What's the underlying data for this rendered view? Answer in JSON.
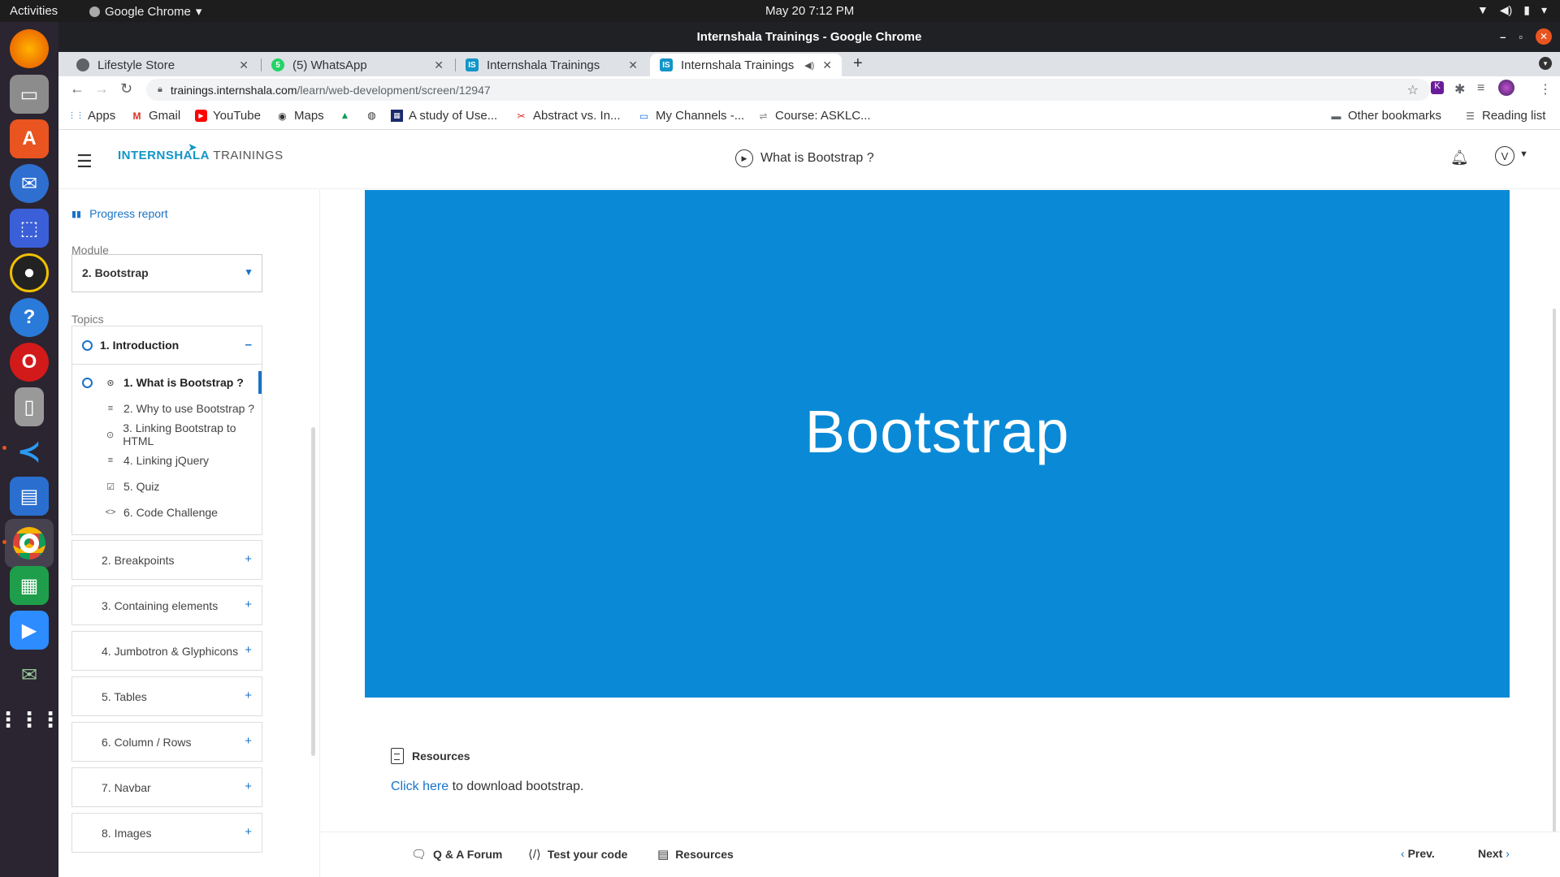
{
  "system": {
    "activities": "Activities",
    "app_name": "Google Chrome",
    "clock": "May 20  7:12 PM"
  },
  "window": {
    "title": "Internshala Trainings - Google Chrome"
  },
  "tabs": [
    {
      "label": "Lifestyle Store",
      "favicon_color": "#5f6368"
    },
    {
      "label": "(5) WhatsApp",
      "favicon_color": "#25d366"
    },
    {
      "label": "Internshala Trainings",
      "favicon_color": "#1295c9",
      "favicon_text": "IS"
    },
    {
      "label": "Internshala Trainings",
      "favicon_color": "#1295c9",
      "favicon_text": "IS",
      "active": true
    }
  ],
  "address": {
    "domain": "trainings.internshala.com",
    "path": "/learn/web-development/screen/12947"
  },
  "bookmarks": [
    {
      "label": "Apps",
      "icon": "apps-grid-icon"
    },
    {
      "label": "Gmail",
      "icon": "gmail-icon"
    },
    {
      "label": "YouTube",
      "icon": "youtube-icon"
    },
    {
      "label": "Maps",
      "icon": "maps-icon"
    },
    {
      "label": "",
      "icon": "drive-icon"
    },
    {
      "label": "",
      "icon": "globe-icon"
    },
    {
      "label": "A study of Use...",
      "icon": "calendar-icon"
    },
    {
      "label": "Abstract vs. In...",
      "icon": "site-icon"
    },
    {
      "label": "My Channels -...",
      "icon": "chat-icon"
    },
    {
      "label": "Course: ASKLC...",
      "icon": "course-icon"
    }
  ],
  "bookmarks_right": [
    {
      "label": "Other bookmarks",
      "icon": "folder-icon"
    },
    {
      "label": "Reading list",
      "icon": "reading-list-icon"
    }
  ],
  "site": {
    "logo_intern": "INTERN",
    "logo_shala": "SHALA",
    "logo_trainings": " TRAININGS",
    "lesson_title": "What is Bootstrap ?",
    "avatar_letter": "V"
  },
  "sidebar": {
    "progress_report": "Progress report",
    "module_label": "Module",
    "module_value": "2. Bootstrap",
    "topics_label": "Topics",
    "current_topic": {
      "title": "1. Introduction",
      "items": [
        {
          "label": "1. What is Bootstrap ?",
          "icon": "play-circle-icon",
          "active": true
        },
        {
          "label": "2. Why to use Bootstrap ?",
          "icon": "text-lines-icon"
        },
        {
          "label": "3. Linking Bootstrap to HTML",
          "icon": "play-circle-icon"
        },
        {
          "label": "4. Linking jQuery",
          "icon": "text-lines-icon"
        },
        {
          "label": "5. Quiz",
          "icon": "checkbox-icon"
        },
        {
          "label": "6. Code Challenge",
          "icon": "code-icon"
        }
      ]
    },
    "other_topics": [
      "2. Breakpoints",
      "3. Containing elements",
      "4. Jumbotron & Glyphicons",
      "5. Tables",
      "6. Column / Rows",
      "7. Navbar",
      "8. Images"
    ]
  },
  "main": {
    "banner_text": "Bootstrap",
    "resources_heading": "Resources",
    "download_link": "Click here",
    "download_rest": " to download bootstrap."
  },
  "footer": {
    "qa_forum": "Q & A Forum",
    "test_code": "Test your code",
    "resources": "Resources",
    "prev": "Prev.",
    "next": "Next"
  }
}
